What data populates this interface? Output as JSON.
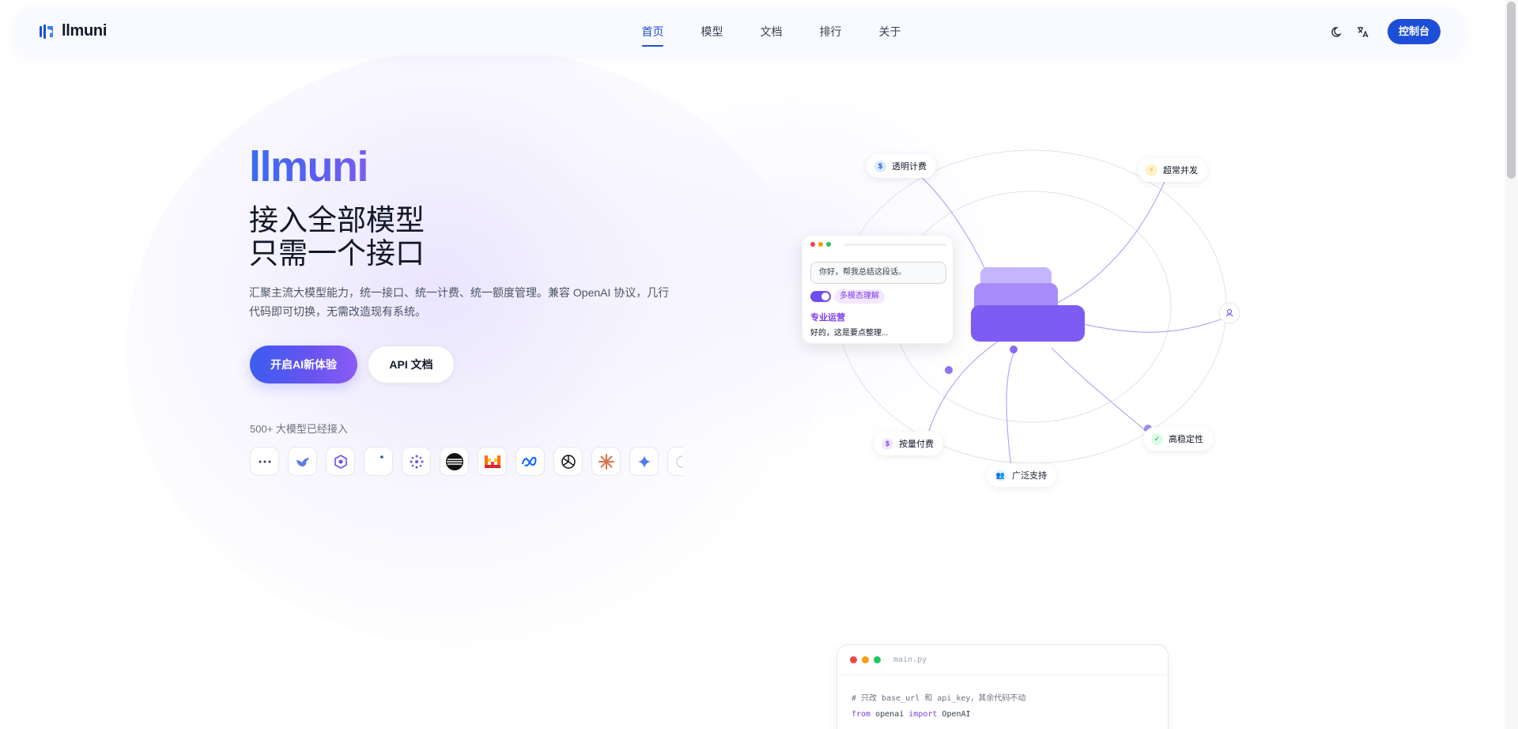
{
  "brand": {
    "name": "llmuni"
  },
  "nav": {
    "links": [
      {
        "label": "首页",
        "active": true
      },
      {
        "label": "模型",
        "active": false
      },
      {
        "label": "文档",
        "active": false
      },
      {
        "label": "排行",
        "active": false
      },
      {
        "label": "关于",
        "active": false
      }
    ],
    "console_label": "控制台",
    "icons": [
      "moon-icon",
      "translate-icon"
    ]
  },
  "hero": {
    "title": "llmuni",
    "subtitle_line1": "接入全部模型",
    "subtitle_line2": "只需一个接口",
    "description": "汇聚主流大模型能力，统一接口、统一计费、统一额度管理。兼容 OpenAI 协议，几行代码即可切换，无需改造现有系统。",
    "primary_button": "开启AI新体验",
    "secondary_button": "API 文档",
    "models_note": "500+ 大模型已经接入",
    "model_icons": [
      "more-icon",
      "deepseek-icon",
      "zhipu-icon",
      "blank-icon",
      "qwen-icon",
      "stripes-icon",
      "mistral-icon",
      "meta-icon",
      "openai-icon",
      "claude-icon",
      "gemini-icon",
      "spinner-icon"
    ]
  },
  "diagram": {
    "pills": {
      "transparent": "透明计费",
      "concurrency": "超常并发",
      "payg": "按量付费",
      "wide": "广泛支持",
      "stable": "高稳定性"
    },
    "chat": {
      "input": "你好，帮我总结这段话。",
      "tag": "多模态理解",
      "label": "专业运营",
      "reply": "好的，这是要点整理..."
    }
  },
  "code": {
    "filename": "main.py",
    "comment": "# 只改 base_url 和 api_key，其余代码不动",
    "line_from": "from",
    "line_module": "openai",
    "line_import": "import",
    "line_name": "OpenAI"
  },
  "colors": {
    "accent": "#1d4ed8",
    "gradient_start": "#3b5cf0",
    "gradient_end": "#8b5cf6"
  }
}
